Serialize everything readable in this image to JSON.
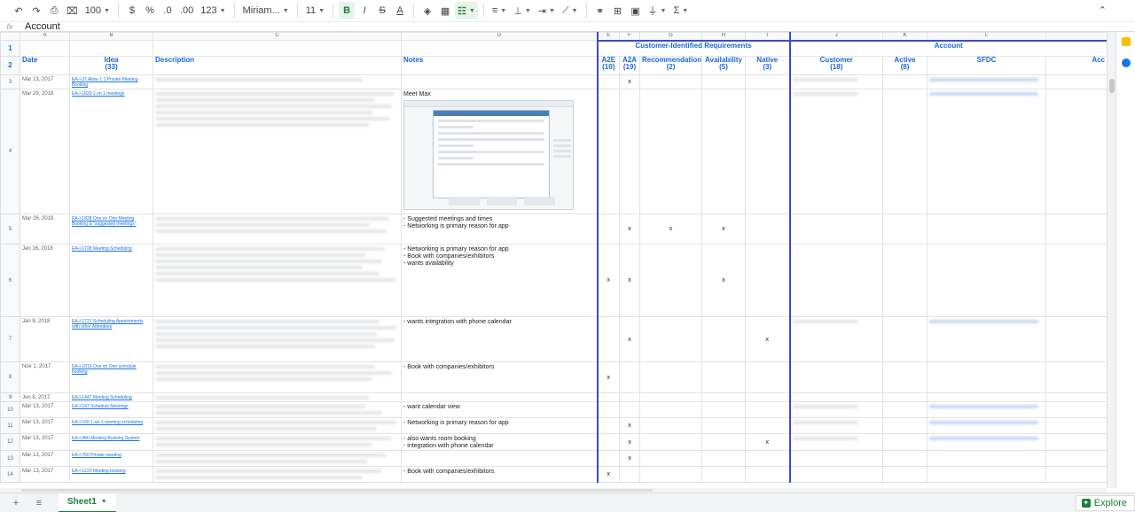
{
  "toolbar": {
    "zoom": "100",
    "currency": "$",
    "percent": "%",
    "decrease_decimal": ".0",
    "increase_decimal": ".00",
    "number_format": "123",
    "font": "Miriam...",
    "font_size": "11",
    "bold": "B",
    "italic": "I",
    "strike": "S",
    "text_color": "A",
    "sigma": "Σ"
  },
  "formula_bar": {
    "fx": "fx",
    "content": "Account"
  },
  "columns": [
    "A",
    "B",
    "C",
    "D",
    "E",
    "F",
    "G",
    "H",
    "I",
    "J",
    "K",
    "L",
    ""
  ],
  "groups": {
    "customer_requirements": "Customer-Identified Requirements",
    "account": "Account"
  },
  "headers": {
    "date": "Date",
    "idea": "Idea",
    "idea_count": "(33)",
    "description": "Description",
    "notes": "Notes",
    "a2e": "A2E",
    "a2e_count": "(10)",
    "a2a": "A2A",
    "a2a_count": "(19)",
    "recommendations": "Recommendations",
    "recommendations_count": "(2)",
    "availability": "Availability",
    "availability_count": "(5)",
    "native": "Native",
    "native_count": "(3)",
    "customer": "Customer",
    "customer_count": "(18)",
    "active": "Active",
    "active_count": "(8)",
    "sfdc": "SFDC",
    "acc": "Acc"
  },
  "rows": [
    {
      "num": "3",
      "date": "Mar 13, 2017",
      "idea": "EA-I-37 Allow 1:1 Private Meeting Booking",
      "notes": "",
      "a2e": "",
      "a2a": "x",
      "rec": "",
      "avail": "",
      "native": ""
    },
    {
      "num": "4",
      "date": "Mar 29, 2018",
      "idea": "EA-I-1833 1 on 1 meetings",
      "notes": "Meet Max",
      "a2e": "",
      "a2a": "",
      "rec": "",
      "avail": "",
      "native": ""
    },
    {
      "num": "5",
      "date": "Mar 26, 2018",
      "idea": "EA-I-1828 One on One Meeting Booking & \"suggested meetings\"",
      "notes": "- Suggested meetings and times\n- Networking is primary reason for app",
      "a2e": "",
      "a2a": "x",
      "rec": "x",
      "avail": "x",
      "native": ""
    },
    {
      "num": "6",
      "date": "Jan 16, 2018",
      "idea": "EA-I-1728 Meeting Scheduling",
      "notes": "- Networking is primary reason for app\n- Book with companies/exhibitors\n- wants availability",
      "a2e": "x",
      "a2a": "x",
      "rec": "",
      "avail": "x",
      "native": ""
    },
    {
      "num": "7",
      "date": "Jan 8, 2018",
      "idea": "EA-I-1721 Scheduling Appointments with other Attendees",
      "notes": "- wants integration with phone calendar",
      "a2e": "",
      "a2a": "x",
      "rec": "",
      "avail": "",
      "native": "x"
    },
    {
      "num": "8",
      "date": "Nov 1, 2017",
      "idea": "EA-I-1819 One on One schedule booking",
      "notes": "- Book with companies/exhibitors",
      "a2e": "x",
      "a2a": "",
      "rec": "",
      "avail": "",
      "native": ""
    },
    {
      "num": "9",
      "date": "Jun 8, 2017",
      "idea": "EA-I-1447 Meeting Scheduling",
      "notes": "",
      "a2e": "",
      "a2a": "",
      "rec": "",
      "avail": "",
      "native": ""
    },
    {
      "num": "10",
      "date": "Mar 13, 2017",
      "idea": "EA-I-147 Schedule Meetings",
      "notes": "- want calendar view",
      "a2e": "",
      "a2a": "",
      "rec": "",
      "avail": "",
      "native": ""
    },
    {
      "num": "11",
      "date": "Mar 13, 2017",
      "idea": "EA-I-156 1-on-1 meeting scheduling",
      "notes": "- Networking is primary reason for app",
      "a2e": "",
      "a2a": "x",
      "rec": "",
      "avail": "",
      "native": ""
    },
    {
      "num": "12",
      "date": "Mar 13, 2017",
      "idea": "EA-I-486 Meeting Booking System",
      "notes": "- also wants room booking\n- integration with phone calendar",
      "a2e": "",
      "a2a": "x",
      "rec": "",
      "avail": "",
      "native": "x"
    },
    {
      "num": "13",
      "date": "Mar 13, 2017",
      "idea": "EA-I-760 Private meeting",
      "notes": "",
      "a2e": "",
      "a2a": "x",
      "rec": "",
      "avail": "",
      "native": ""
    },
    {
      "num": "14",
      "date": "Mar 13, 2017",
      "idea": "EA-I-1220 Meeting booking",
      "notes": "- Book with companies/exhibitors",
      "a2e": "x",
      "a2a": "",
      "rec": "",
      "avail": "",
      "native": ""
    }
  ],
  "bottom": {
    "sheet_name": "Sheet1",
    "explore": "Explore"
  }
}
